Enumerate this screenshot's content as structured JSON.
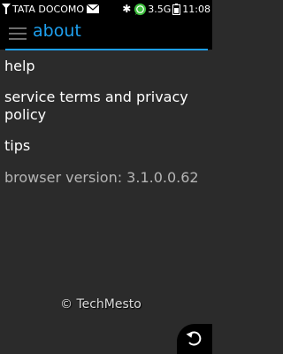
{
  "status_bar": {
    "carrier": "TATA DOCOMO",
    "network": "3.5G",
    "time": "11:08",
    "icons": [
      "signal-icon",
      "mail-icon",
      "bluetooth-icon",
      "whatsapp-icon",
      "battery-icon"
    ]
  },
  "header": {
    "title": "about",
    "menu_icon": "menu-icon",
    "accent_color": "#1ea0ef"
  },
  "menu": {
    "items": [
      {
        "label": "help"
      },
      {
        "label": "service terms and privacy policy"
      },
      {
        "label": "tips"
      }
    ],
    "version": "browser version: 3.1.0.0.62"
  },
  "watermark": "© TechMesto",
  "back_button_icon": "back-arrow-icon"
}
